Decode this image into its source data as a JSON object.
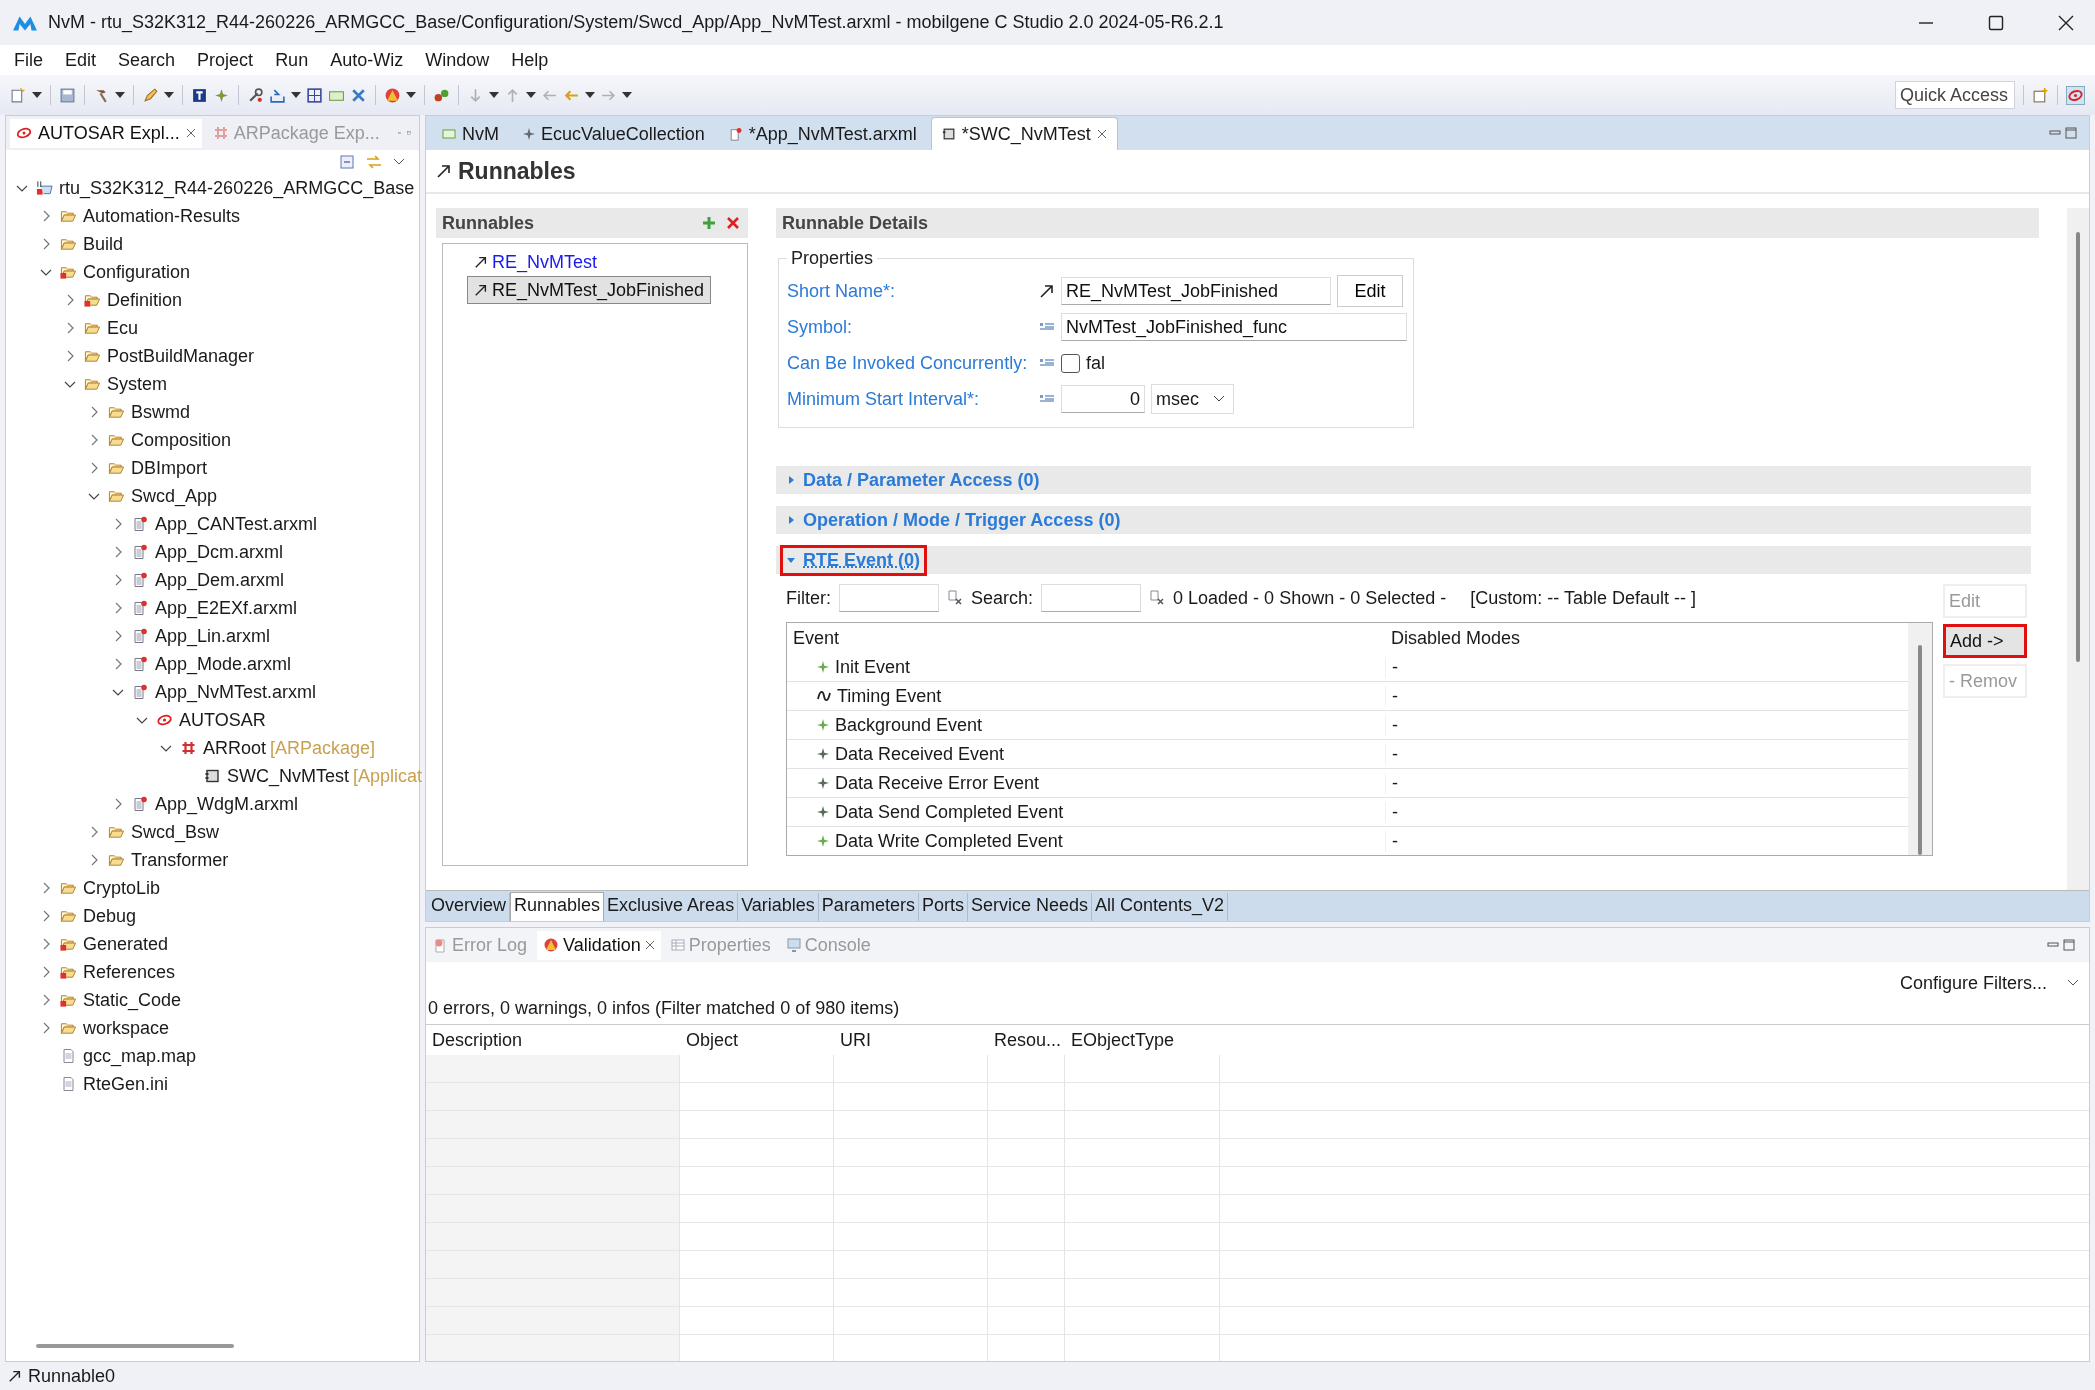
{
  "window": {
    "title": "NvM - rtu_S32K312_R44-260226_ARMGCC_Base/Configuration/System/Swcd_App/App_NvMTest.arxml - mobilgene C Studio 2.0 2024-05-R6.2.1"
  },
  "menu": [
    "File",
    "Edit",
    "Search",
    "Project",
    "Run",
    "Auto-Wiz",
    "Window",
    "Help"
  ],
  "quick_access": {
    "placeholder": "Quick Access"
  },
  "explorer": {
    "tabs": [
      {
        "label": "AUTOSAR Expl...",
        "selected": true
      },
      {
        "label": "ARPackage Exp...",
        "selected": false
      }
    ],
    "tree": [
      {
        "label": "rtu_S32K312_R44-260226_ARMGCC_Base",
        "kind": "project",
        "expanded": true,
        "children": [
          {
            "label": "Automation-Results",
            "kind": "folder",
            "expanded": false
          },
          {
            "label": "Build",
            "kind": "folder",
            "expanded": false
          },
          {
            "label": "Configuration",
            "kind": "redfolder",
            "expanded": true,
            "children": [
              {
                "label": "Definition",
                "kind": "redfolder",
                "expanded": false
              },
              {
                "label": "Ecu",
                "kind": "folder",
                "expanded": false
              },
              {
                "label": "PostBuildManager",
                "kind": "folder",
                "expanded": false
              },
              {
                "label": "System",
                "kind": "folder",
                "expanded": true,
                "children": [
                  {
                    "label": "Bswmd",
                    "kind": "folder",
                    "expanded": false
                  },
                  {
                    "label": "Composition",
                    "kind": "folder",
                    "expanded": false
                  },
                  {
                    "label": "DBImport",
                    "kind": "folder",
                    "expanded": false
                  },
                  {
                    "label": "Swcd_App",
                    "kind": "folder",
                    "expanded": true,
                    "children": [
                      {
                        "label": "App_CANTest.arxml",
                        "kind": "file",
                        "expanded": false
                      },
                      {
                        "label": "App_Dcm.arxml",
                        "kind": "file",
                        "expanded": false
                      },
                      {
                        "label": "App_Dem.arxml",
                        "kind": "file",
                        "expanded": false
                      },
                      {
                        "label": "App_E2EXf.arxml",
                        "kind": "file",
                        "expanded": false
                      },
                      {
                        "label": "App_Lin.arxml",
                        "kind": "file",
                        "expanded": false
                      },
                      {
                        "label": "App_Mode.arxml",
                        "kind": "file",
                        "expanded": false
                      },
                      {
                        "label": "App_NvMTest.arxml",
                        "kind": "file",
                        "expanded": true,
                        "children": [
                          {
                            "label": "AUTOSAR",
                            "kind": "autosar",
                            "expanded": true,
                            "children": [
                              {
                                "label": "ARRoot",
                                "annotation": "[ARPackage]",
                                "kind": "package",
                                "expanded": true,
                                "children": [
                                  {
                                    "label": "SWC_NvMTest",
                                    "annotation": "[Applicat",
                                    "kind": "component"
                                  }
                                ]
                              }
                            ]
                          }
                        ]
                      },
                      {
                        "label": "App_WdgM.arxml",
                        "kind": "file",
                        "expanded": false
                      }
                    ]
                  },
                  {
                    "label": "Swcd_Bsw",
                    "kind": "folder",
                    "expanded": false
                  },
                  {
                    "label": "Transformer",
                    "kind": "folder",
                    "expanded": false
                  }
                ]
              }
            ]
          },
          {
            "label": "CryptoLib",
            "kind": "folder",
            "expanded": false
          },
          {
            "label": "Debug",
            "kind": "folder",
            "expanded": false
          },
          {
            "label": "Generated",
            "kind": "redfolder",
            "expanded": false
          },
          {
            "label": "References",
            "kind": "redfolder",
            "expanded": false
          },
          {
            "label": "Static_Code",
            "kind": "redfolder",
            "expanded": false
          },
          {
            "label": "workspace",
            "kind": "folder",
            "expanded": false
          },
          {
            "label": "gcc_map.map",
            "kind": "plainfile"
          },
          {
            "label": "RteGen.ini",
            "kind": "plainfile"
          }
        ]
      }
    ]
  },
  "editor_tabs": [
    {
      "label": "NvM",
      "kind": "module",
      "selected": false
    },
    {
      "label": "EcucValueCollection",
      "kind": "collection",
      "selected": false
    },
    {
      "label": "*App_NvMTest.arxml",
      "kind": "file",
      "selected": false
    },
    {
      "label": "*SWC_NvMTest",
      "kind": "component",
      "selected": true
    }
  ],
  "editor": {
    "title": "Runnables",
    "runnables": {
      "heading": "Runnables",
      "items": [
        {
          "label": "RE_NvMTest",
          "selected": false
        },
        {
          "label": "RE_NvMTest_JobFinished",
          "selected": true
        }
      ]
    },
    "details": {
      "heading": "Runnable Details",
      "group": "Properties",
      "short_name": {
        "label": "Short Name*:",
        "value": "RE_NvMTest_JobFinished",
        "button": "Edit"
      },
      "symbol": {
        "label": "Symbol:",
        "value": "NvMTest_JobFinished_func"
      },
      "concurrent": {
        "label": "Can Be Invoked Concurrently:",
        "checked": false,
        "text": "fal"
      },
      "min_start": {
        "label": "Minimum Start Interval*:",
        "value": "0",
        "unit": "msec"
      }
    },
    "sections": [
      {
        "title": "Data / Parameter Access (0)",
        "expanded": false,
        "highlighted": false
      },
      {
        "title": "Operation / Mode / Trigger Access (0)",
        "expanded": false,
        "highlighted": false
      },
      {
        "title": "RTE Event (0)",
        "expanded": true,
        "highlighted": true
      }
    ],
    "rte_event": {
      "filter_label": "Filter:",
      "search_label": "Search:",
      "status": "0 Loaded - 0 Shown - 0 Selected -",
      "custom": "[Custom: -- Table Default -- ]",
      "columns": [
        "Event",
        "Disabled Modes"
      ],
      "rows": [
        {
          "event": "Init Event",
          "kind": "init",
          "disabled_modes": "-"
        },
        {
          "event": "Timing Event",
          "kind": "timing",
          "disabled_modes": "-"
        },
        {
          "event": "Background Event",
          "kind": "init",
          "disabled_modes": "-"
        },
        {
          "event": "Data Received Event",
          "kind": "data",
          "disabled_modes": "-"
        },
        {
          "event": "Data Receive Error Event",
          "kind": "data",
          "disabled_modes": "-"
        },
        {
          "event": "Data Send Completed Event",
          "kind": "data",
          "disabled_modes": "-"
        },
        {
          "event": "Data Write Completed Event",
          "kind": "init",
          "disabled_modes": "-"
        }
      ],
      "buttons": [
        {
          "label": "Edit",
          "disabled": true,
          "highlighted": false
        },
        {
          "label": "Add ->",
          "disabled": false,
          "highlighted": true
        },
        {
          "label": "- Remov",
          "disabled": true,
          "highlighted": false
        }
      ]
    }
  },
  "page_tabs": [
    {
      "label": "Overview",
      "selected": false
    },
    {
      "label": "Runnables",
      "selected": true
    },
    {
      "label": "Exclusive Areas",
      "selected": false
    },
    {
      "label": "Variables",
      "selected": false
    },
    {
      "label": "Parameters",
      "selected": false
    },
    {
      "label": "Ports",
      "selected": false
    },
    {
      "label": "Service Needs",
      "selected": false
    },
    {
      "label": "All Contents_V2",
      "selected": false
    }
  ],
  "bottom": {
    "tabs": [
      {
        "label": "Error Log",
        "kind": "errorlog",
        "selected": false
      },
      {
        "label": "Validation",
        "kind": "validation",
        "selected": true
      },
      {
        "label": "Properties",
        "kind": "properties",
        "selected": false
      },
      {
        "label": "Console",
        "kind": "console",
        "selected": false
      }
    ],
    "configure": "Configure Filters...",
    "summary": "0 errors, 0 warnings, 0 infos (Filter matched 0 of 980 items)",
    "columns": [
      "Description",
      "Object",
      "URI",
      "Resou...",
      "EObjectType"
    ]
  },
  "status_bar": "Runnable0"
}
